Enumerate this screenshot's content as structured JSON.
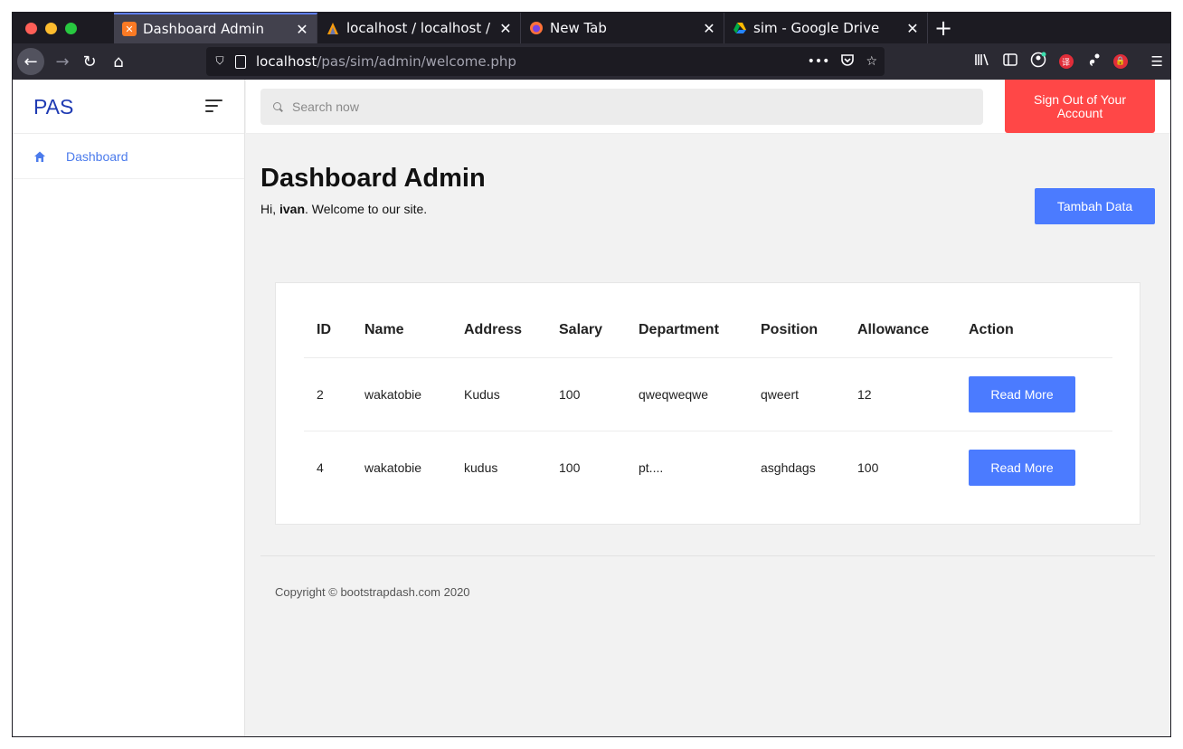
{
  "browser": {
    "tabs": [
      {
        "title": "Dashboard Admin",
        "icon": "xampp-icon",
        "active": true
      },
      {
        "title": "localhost / localhost / crud",
        "icon": "phpmyadmin-icon",
        "active": false
      },
      {
        "title": "New Tab",
        "icon": "firefox-icon",
        "active": false
      },
      {
        "title": "sim - Google Drive",
        "icon": "google-drive-icon",
        "active": false
      }
    ],
    "url_host": "localhost",
    "url_path": "/pas/sim/admin/welcome.php"
  },
  "sidebar": {
    "brand": "PAS",
    "items": [
      {
        "label": "Dashboard",
        "icon": "home-icon"
      }
    ]
  },
  "topbar": {
    "search_placeholder": "Search now",
    "signout_label": "Sign Out of Your Account"
  },
  "main": {
    "title": "Dashboard Admin",
    "greeting_prefix": "Hi, ",
    "username": "ivan",
    "greeting_suffix": ". Welcome to our site.",
    "add_button": "Tambah Data"
  },
  "table": {
    "headers": [
      "ID",
      "Name",
      "Address",
      "Salary",
      "Department",
      "Position",
      "Allowance",
      "Action"
    ],
    "rows": [
      {
        "id": "2",
        "name": "wakatobie",
        "address": "Kudus",
        "salary": "100",
        "department": "qweqweqwe",
        "position": "qweert",
        "allowance": "12",
        "action": "Read More"
      },
      {
        "id": "4",
        "name": "wakatobie",
        "address": "kudus",
        "salary": "100",
        "department": "pt....",
        "position": "asghdags",
        "allowance": "100",
        "action": "Read More"
      }
    ]
  },
  "footer": {
    "copyright": "Copyright © bootstrapdash.com 2020"
  },
  "colors": {
    "accent": "#4b7bff",
    "danger": "#ff4747",
    "brand": "#1f3bb3"
  }
}
